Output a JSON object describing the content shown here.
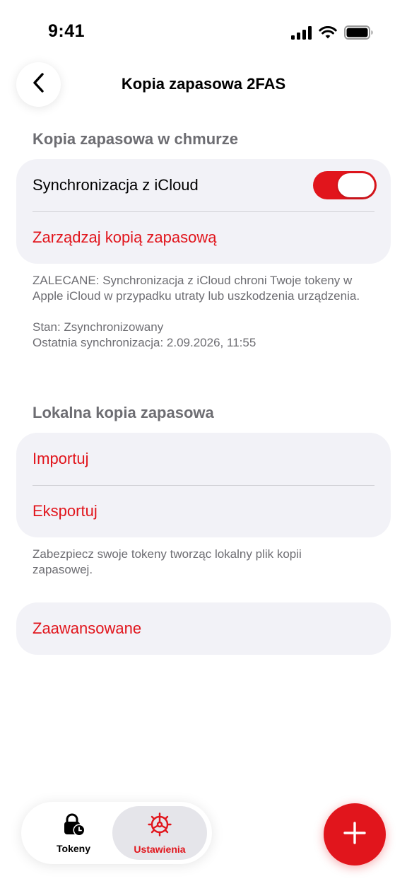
{
  "status_bar": {
    "time": "9:41",
    "icons": [
      "cellular-signal-icon",
      "wifi-icon",
      "battery-icon"
    ]
  },
  "nav": {
    "back_icon": "chevron-left-icon",
    "title": "Kopia zapasowa 2FAS"
  },
  "cloud_section": {
    "header": "Kopia zapasowa w chmurze",
    "sync_label": "Synchronizacja z iCloud",
    "sync_enabled": true,
    "manage_label": "Zarządzaj kopią zapasową",
    "recommendation": "ZALECANE: Synchronizacja z iCloud chroni Twoje tokeny w Apple iCloud w przypadku utraty lub uszkodzenia urządzenia.",
    "status_line": "Stan: Zsynchronizowany",
    "last_sync_line": "Ostatnia synchronizacja: 2.09.2026, 11:55"
  },
  "local_section": {
    "header": "Lokalna kopia zapasowa",
    "import_label": "Importuj",
    "export_label": "Eksportuj",
    "footnote": "Zabezpiecz swoje tokeny tworząc lokalny plik kopii zapasowej."
  },
  "advanced": {
    "label": "Zaawansowane"
  },
  "tab_bar": {
    "tabs": [
      {
        "label": "Tokeny",
        "icon": "lock-clock-icon",
        "selected": false
      },
      {
        "label": "Ustawienia",
        "icon": "gear-icon",
        "selected": true
      }
    ]
  },
  "fab": {
    "icon": "plus-icon"
  },
  "colors": {
    "accent": "#e1151c",
    "secondary_text": "#6d6d72",
    "group_background": "#f2f2f7",
    "selected_tab_background": "#e5e5ea"
  }
}
